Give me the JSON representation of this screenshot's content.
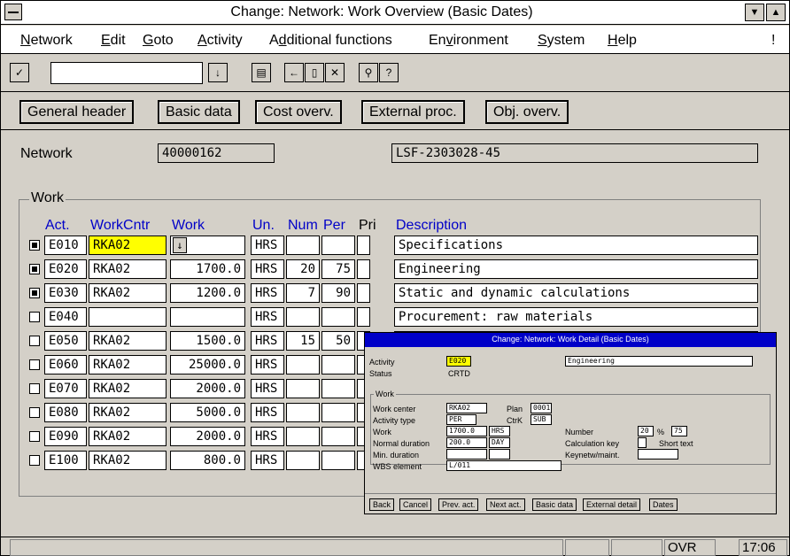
{
  "window": {
    "title": "Change: Network: Work Overview (Basic Dates)"
  },
  "menu": [
    {
      "pre": "",
      "u": "N",
      "post": "etwork"
    },
    {
      "pre": "",
      "u": "E",
      "post": "dit"
    },
    {
      "pre": "",
      "u": "G",
      "post": "oto"
    },
    {
      "pre": "",
      "u": "A",
      "post": "ctivity"
    },
    {
      "pre": "A",
      "u": "d",
      "post": "ditional functions"
    },
    {
      "pre": "En",
      "u": "v",
      "post": "ironment"
    },
    {
      "pre": "",
      "u": "S",
      "post": "ystem"
    },
    {
      "pre": "",
      "u": "H",
      "post": "elp"
    }
  ],
  "menu_end": "!",
  "toolbar": {
    "command_value": ""
  },
  "app_buttons": [
    "General header",
    "Basic data",
    "Cost overv.",
    "External proc.",
    "Obj. overv."
  ],
  "network": {
    "label": "Network",
    "number": "40000162",
    "description": "LSF-2303028-45"
  },
  "work": {
    "group_title": "Work",
    "headers": {
      "act": "Act.",
      "workcntr": "WorkCntr",
      "work": "Work",
      "un": "Un.",
      "num": "Num",
      "per": "Per",
      "pri": "Pri",
      "desc": "Description"
    },
    "rows": [
      {
        "checked": true,
        "act": "E010",
        "workcntr": "RKA02",
        "work": "",
        "un": "HRS",
        "num": "",
        "per": "",
        "desc": "Specifications"
      },
      {
        "checked": true,
        "act": "E020",
        "workcntr": "RKA02",
        "work": "1700.0",
        "un": "HRS",
        "num": "20",
        "per": "75",
        "desc": "Engineering"
      },
      {
        "checked": true,
        "act": "E030",
        "workcntr": "RKA02",
        "work": "1200.0",
        "un": "HRS",
        "num": "7",
        "per": "90",
        "desc": "Static and dynamic calculations"
      },
      {
        "checked": false,
        "act": "E040",
        "workcntr": "",
        "work": "",
        "un": "HRS",
        "num": "",
        "per": "",
        "desc": "Procurement: raw materials"
      },
      {
        "checked": false,
        "act": "E050",
        "workcntr": "RKA02",
        "work": "1500.0",
        "un": "HRS",
        "num": "15",
        "per": "50",
        "desc": ""
      },
      {
        "checked": false,
        "act": "E060",
        "workcntr": "RKA02",
        "work": "25000.0",
        "un": "HRS",
        "num": "",
        "per": "",
        "desc": ""
      },
      {
        "checked": false,
        "act": "E070",
        "workcntr": "RKA02",
        "work": "2000.0",
        "un": "HRS",
        "num": "",
        "per": "",
        "desc": ""
      },
      {
        "checked": false,
        "act": "E080",
        "workcntr": "RKA02",
        "work": "5000.0",
        "un": "HRS",
        "num": "",
        "per": "",
        "desc": ""
      },
      {
        "checked": false,
        "act": "E090",
        "workcntr": "RKA02",
        "work": "2000.0",
        "un": "HRS",
        "num": "",
        "per": "",
        "desc": ""
      },
      {
        "checked": false,
        "act": "E100",
        "workcntr": "RKA02",
        "work": "800.0",
        "un": "HRS",
        "num": "",
        "per": "",
        "desc": ""
      }
    ]
  },
  "popup": {
    "title": "Change: Network: Work Detail (Basic Dates)",
    "activity_label": "Activity",
    "activity_value": "E020",
    "activity_desc": "Engineering",
    "status_label": "Status",
    "status_value": "CRTD",
    "group_title": "Work",
    "work_center_label": "Work center",
    "work_center_value": "RKA02",
    "plan_label": "Plan",
    "plan_value": "0001",
    "activity_type_label": "Activity type",
    "activity_type_value": "PER",
    "ctrk_label": "CtrK",
    "ctrk_value": "SUB",
    "work_label": "Work",
    "work_value": "1700.0",
    "work_unit": "HRS",
    "number_label": "Number",
    "number_value": "20",
    "percent_sign": "%",
    "percent_value": "75",
    "normal_duration_label": "Normal duration",
    "normal_duration_value": "200.0",
    "normal_duration_unit": "DAY",
    "calc_key_label": "Calculation key",
    "short_text_label": "Short text",
    "min_duration_label": "Min. duration",
    "keynet_label": "Keynetw/maint.",
    "wbs_label": "WBS element",
    "wbs_value": "L/011",
    "buttons": [
      "Back",
      "Cancel",
      "Prev. act.",
      "Next act.",
      "Basic data",
      "External detail",
      "Dates"
    ]
  },
  "statusbar": {
    "mode": "OVR",
    "time": "17:06"
  }
}
